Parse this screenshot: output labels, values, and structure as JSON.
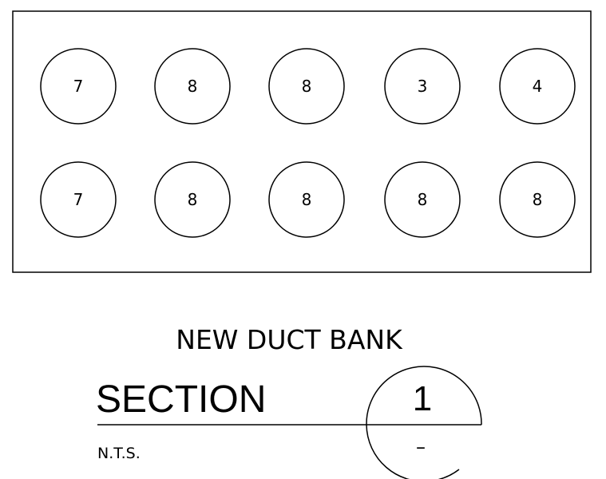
{
  "duct_bank": {
    "rows": [
      [
        "7",
        "8",
        "8",
        "3",
        "4"
      ],
      [
        "7",
        "8",
        "8",
        "8",
        "8"
      ]
    ]
  },
  "caption": "NEW DUCT BANK",
  "section": {
    "label": "SECTION",
    "number": "1",
    "scale": "N.T.S.",
    "sheet_ref": "–"
  }
}
